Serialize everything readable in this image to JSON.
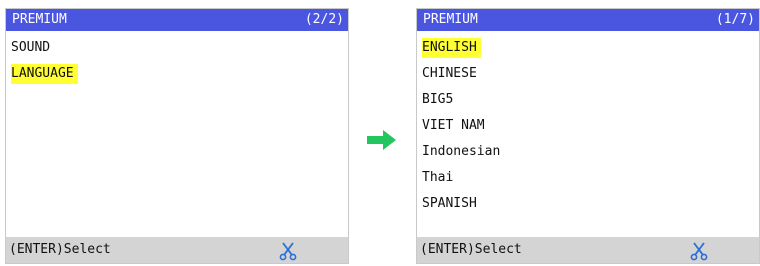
{
  "left_screen": {
    "title": "PREMIUM",
    "page": "(2/2)",
    "items": [
      {
        "label": "SOUND",
        "selected": false
      },
      {
        "label": "LANGUAGE",
        "selected": true
      }
    ],
    "footer_hint": "(ENTER)Select",
    "footer_icon": "scissors-icon"
  },
  "right_screen": {
    "title": "PREMIUM",
    "page": "(1/7)",
    "items": [
      {
        "label": "ENGLISH",
        "selected": true
      },
      {
        "label": "CHINESE",
        "selected": false
      },
      {
        "label": "BIG5",
        "selected": false
      },
      {
        "label": "VIET NAM",
        "selected": false
      },
      {
        "label": "Indonesian",
        "selected": false
      },
      {
        "label": "Thai",
        "selected": false
      },
      {
        "label": "SPANISH",
        "selected": false
      }
    ],
    "footer_hint": "(ENTER)Select",
    "footer_icon": "scissors-icon"
  },
  "transition_icon": "right-arrow-icon",
  "colors": {
    "title_bar": "#4a55e0",
    "highlight": "#ffff33",
    "footer": "#d4d4d4",
    "arrow": "#22c55e",
    "scissors": "#2a6fd6"
  }
}
